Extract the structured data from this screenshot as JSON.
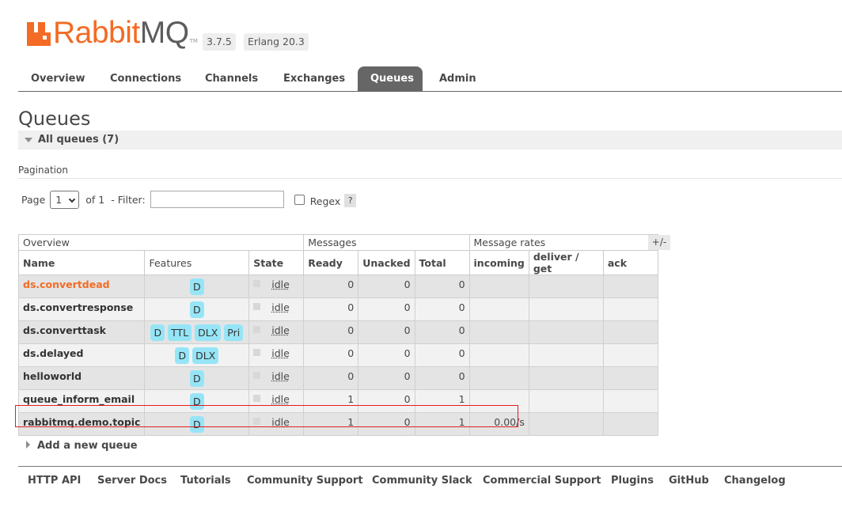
{
  "header": {
    "brand_prefix": "Rabbit",
    "brand_suffix": "MQ",
    "tm": "TM",
    "version": "3.7.5",
    "erlang": "Erlang 20.3"
  },
  "tabs": [
    {
      "label": "Overview"
    },
    {
      "label": "Connections"
    },
    {
      "label": "Channels"
    },
    {
      "label": "Exchanges"
    },
    {
      "label": "Queues",
      "active": true
    },
    {
      "label": "Admin"
    }
  ],
  "page_title": "Queues",
  "section": {
    "label": "All queues (7)"
  },
  "pagination": {
    "label": "Pagination",
    "page_label": "Page",
    "page_value": "1",
    "of_label": "of 1",
    "filter_label": "- Filter:",
    "filter_value": "",
    "regex_label": "Regex",
    "help_label": "?"
  },
  "table": {
    "groups": [
      "Overview",
      "Messages",
      "Message rates"
    ],
    "toggle_label": "+/-",
    "columns": [
      "Name",
      "Features",
      "State",
      "Ready",
      "Unacked",
      "Total",
      "incoming",
      "deliver / get",
      "ack"
    ],
    "rows": [
      {
        "name": "ds.convertdead",
        "features": [
          "D"
        ],
        "state": "idle",
        "ready": "0",
        "unacked": "0",
        "total": "0",
        "incoming": "",
        "deliver": "",
        "ack": ""
      },
      {
        "name": "ds.convertresponse",
        "features": [
          "D"
        ],
        "state": "idle",
        "ready": "0",
        "unacked": "0",
        "total": "0",
        "incoming": "",
        "deliver": "",
        "ack": ""
      },
      {
        "name": "ds.converttask",
        "features": [
          "D",
          "TTL",
          "DLX",
          "Pri"
        ],
        "state": "idle",
        "ready": "0",
        "unacked": "0",
        "total": "0",
        "incoming": "",
        "deliver": "",
        "ack": ""
      },
      {
        "name": "ds.delayed",
        "features": [
          "D",
          "DLX"
        ],
        "state": "idle",
        "ready": "0",
        "unacked": "0",
        "total": "0",
        "incoming": "",
        "deliver": "",
        "ack": ""
      },
      {
        "name": "helloworld",
        "features": [
          "D"
        ],
        "state": "idle",
        "ready": "0",
        "unacked": "0",
        "total": "0",
        "incoming": "",
        "deliver": "",
        "ack": ""
      },
      {
        "name": "queue_inform_email",
        "features": [
          "D"
        ],
        "state": "idle",
        "ready": "1",
        "unacked": "0",
        "total": "1",
        "incoming": "",
        "deliver": "",
        "ack": ""
      },
      {
        "name": "rabbitmq.demo.topic",
        "features": [
          "D"
        ],
        "state": "idle",
        "ready": "1",
        "unacked": "0",
        "total": "1",
        "incoming": "0.00/s",
        "deliver": "",
        "ack": ""
      }
    ]
  },
  "add_queue": "Add a new queue",
  "footer": [
    "HTTP API",
    "Server Docs",
    "Tutorials",
    "Community Support",
    "Community Slack",
    "Commercial Support",
    "Plugins",
    "GitHub",
    "Changelog"
  ],
  "colors": {
    "brand": "#f36b24",
    "active_tab": "#666666",
    "chip": "#96e5f7",
    "highlight_border": "#e02020"
  }
}
